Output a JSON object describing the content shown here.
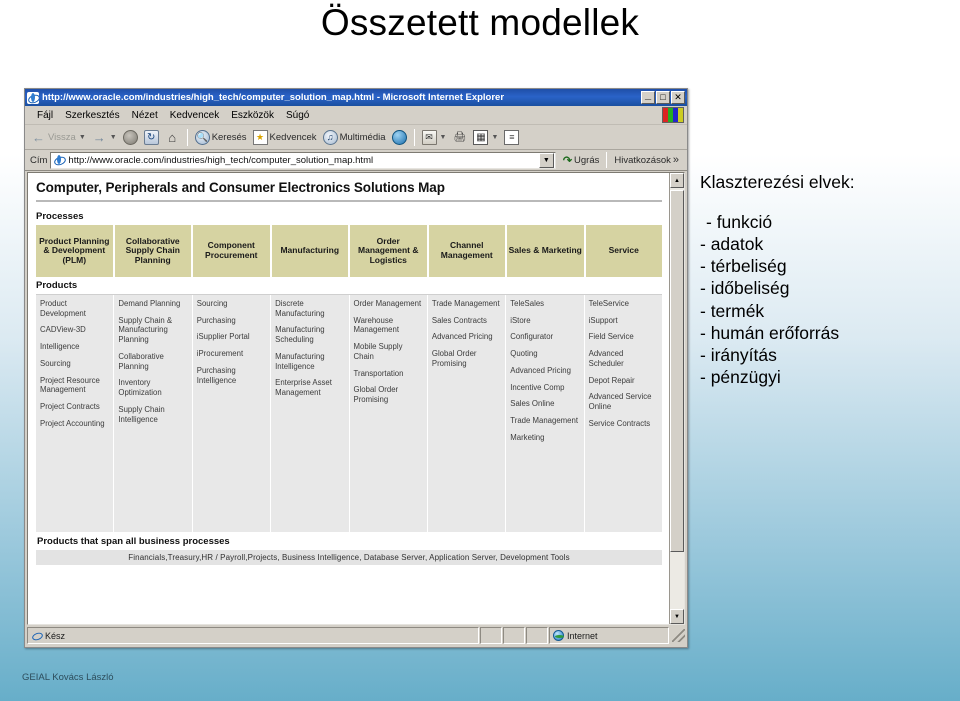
{
  "slide": {
    "title": "Összetett modellek",
    "footer": "GEIAL Kovács László"
  },
  "browser": {
    "window_title": "http://www.oracle.com/industries/high_tech/computer_solution_map.html - Microsoft Internet Explorer",
    "window_buttons": {
      "minimize": "_",
      "maximize": "□",
      "close": "✕"
    },
    "menu": [
      "Fájl",
      "Szerkesztés",
      "Nézet",
      "Kedvencek",
      "Eszközök",
      "Súgó"
    ],
    "toolbar": {
      "back": "Vissza",
      "forward": "",
      "stop": "",
      "refresh": "",
      "home": "",
      "search": "Keresés",
      "favorites": "Kedvencek",
      "media": "Multimédia",
      "history": "",
      "mail": "",
      "print": "",
      "edit": "",
      "discuss": ""
    },
    "address": {
      "label": "Cím",
      "url": "http://www.oracle.com/industries/high_tech/computer_solution_map.html",
      "go": "Ugrás",
      "links": "Hivatkozások",
      "links_chevron": "»"
    },
    "status": {
      "text": "Kész",
      "zone": "Internet"
    }
  },
  "map": {
    "title": "Computer, Peripherals and Consumer Electronics Solutions Map",
    "processes_label": "Processes",
    "products_label": "Products",
    "span_label": "Products that span all business processes",
    "span_text": "Financials,Treasury,HR / Payroll,Projects, Business Intelligence, Database Server, Application Server, Development Tools",
    "columns": [
      {
        "process": "Product Planning & Development (PLM)",
        "products": [
          "Product Development",
          "CADView-3D",
          "Intelligence",
          "Sourcing",
          "Project Resource Management",
          "Project Contracts",
          "Project Accounting"
        ]
      },
      {
        "process": "Collaborative Supply Chain Planning",
        "products": [
          "Demand Planning",
          "Supply Chain & Manufacturing Planning",
          "Collaborative Planning",
          "Inventory Optimization",
          "Supply Chain Intelligence"
        ]
      },
      {
        "process": "Component Procurement",
        "products": [
          "Sourcing",
          "Purchasing",
          "iSupplier Portal",
          "iProcurement",
          "Purchasing Intelligence"
        ]
      },
      {
        "process": "Manufacturing",
        "products": [
          "Discrete Manufacturing",
          "Manufacturing Scheduling",
          "Manufacturing Intelligence",
          "Enterprise Asset Management"
        ]
      },
      {
        "process": "Order Management & Logistics",
        "products": [
          "Order Management",
          "Warehouse Management",
          "Mobile Supply Chain",
          "Transportation",
          "Global Order Promising"
        ]
      },
      {
        "process": "Channel Management",
        "products": [
          "Trade Management",
          "Sales Contracts",
          "Advanced Pricing",
          "Global Order Promising"
        ]
      },
      {
        "process": "Sales & Marketing",
        "products": [
          "TeleSales",
          "iStore",
          "Configurator",
          "Quoting",
          "Advanced Pricing",
          "Incentive Comp",
          "Sales Online",
          "Trade Management",
          "Marketing"
        ]
      },
      {
        "process": "Service",
        "products": [
          "TeleService",
          "iSupport",
          "Field Service",
          "Advanced Scheduler",
          "Depot Repair",
          "Advanced Service Online",
          "Service Contracts"
        ]
      }
    ]
  },
  "right_panel": {
    "heading": "Klaszterezési elvek:",
    "bullets": [
      "- funkció",
      "- adatok",
      "- térbeliség",
      "- időbeliség",
      "- termék",
      "- humán erőforrás",
      "- irányítás",
      "- pénzügyi"
    ]
  },
  "colors": {
    "process_header": "#d6d3a2",
    "product_bg": "#e8e8e8",
    "titlebar": "#1f4fa8",
    "chrome": "#d4d0c8",
    "slide_bg_bottom": "#67aec9"
  }
}
